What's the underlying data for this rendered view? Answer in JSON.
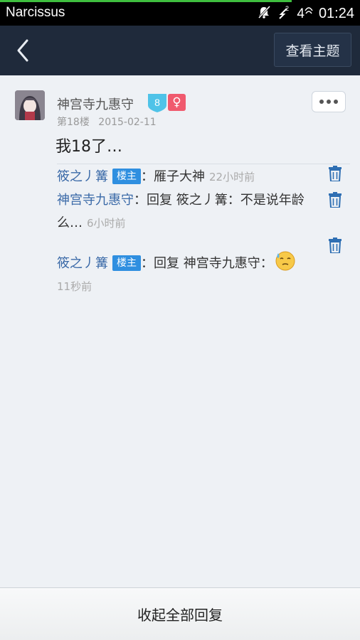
{
  "status_bar": {
    "carrier": "Narcissus",
    "signal_superscript": "2",
    "network_label": "4",
    "time": "01:24",
    "icons": [
      "mute-bell-icon",
      "signal-icon",
      "wifi-icon"
    ]
  },
  "nav": {
    "back_icon": "chevron-left-icon",
    "view_topic_label": "查看主题"
  },
  "post": {
    "author": "神宫寺九惠守",
    "level": "8",
    "gender_symbol": "♀",
    "floor": "第18楼",
    "date": "2015-02-11",
    "text": "我18了…"
  },
  "replies": [
    {
      "user": "筱之丿篝",
      "is_op": true,
      "op_label": "楼主",
      "separator": "：",
      "text": "雁子大神",
      "time": "22小时前"
    },
    {
      "user": "神宫寺九惠守",
      "is_op": false,
      "separator": "：",
      "text": "回复 筱之丿篝：不是说年龄么…",
      "time": "6小时前"
    },
    {
      "user": "筱之丿篝",
      "is_op": true,
      "op_label": "楼主",
      "separator": "：",
      "text": "回复 神宫寺九惠守：",
      "emoji": "sweat-emoji-icon",
      "time": "11秒前"
    }
  ],
  "footer": {
    "collapse_label": "收起全部回复"
  },
  "colors": {
    "nav_bg": "#1f2a3b",
    "link_blue": "#3b6aa8",
    "op_tag": "#2f8fe0",
    "level_badge": "#4fc3e8",
    "gender_badge": "#f05a6e"
  }
}
